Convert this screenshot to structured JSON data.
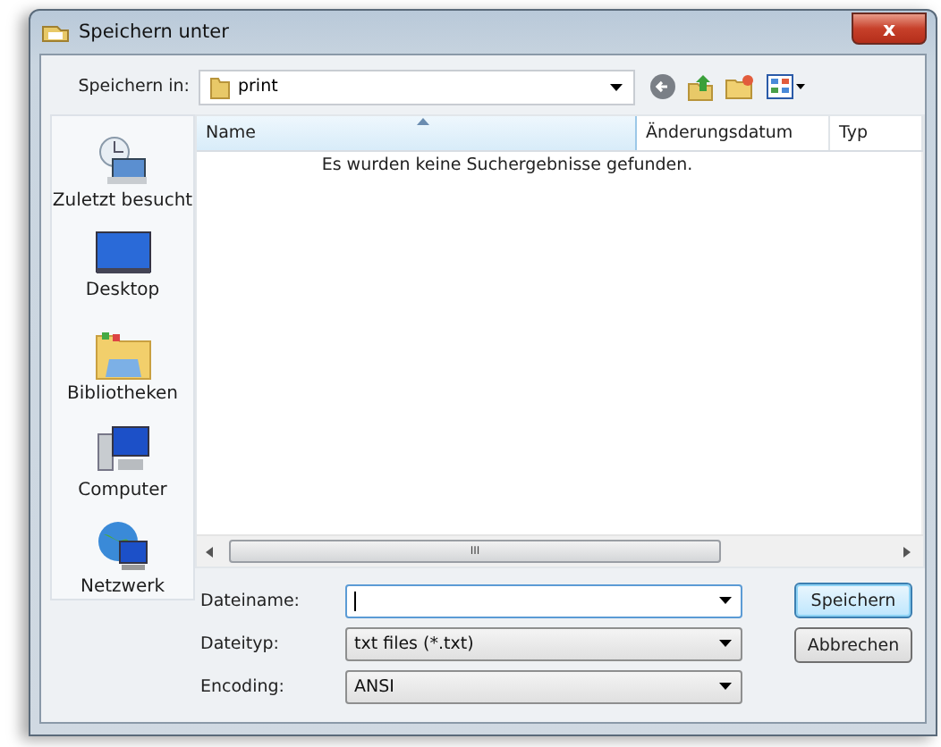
{
  "window": {
    "title": "Speichern unter",
    "close": "x"
  },
  "location": {
    "label": "Speichern in:",
    "value": "print"
  },
  "places": [
    {
      "label": "Zuletzt besucht",
      "kind": "recent"
    },
    {
      "label": "Desktop",
      "kind": "desktop"
    },
    {
      "label": "Bibliotheken",
      "kind": "libraries"
    },
    {
      "label": "Computer",
      "kind": "computer"
    },
    {
      "label": "Netzwerk",
      "kind": "network"
    }
  ],
  "table": {
    "columns": [
      {
        "label": "Name",
        "sorted": true
      },
      {
        "label": "Änderungsdatum",
        "sorted": false
      },
      {
        "label": "Typ",
        "sorted": false
      }
    ],
    "empty_message": "Es wurden keine Suchergebnisse gefunden."
  },
  "scrollbar": {
    "grip": "III"
  },
  "fields": [
    {
      "label": "Dateiname:",
      "focused": true
    },
    {
      "label": "Dateityp:",
      "value": "txt files (*.txt)",
      "focused": false
    },
    {
      "label": "Encoding:",
      "value": "ANSI",
      "focused": false
    }
  ],
  "buttons": [
    {
      "label": "Speichern",
      "default": true
    },
    {
      "label": "Abbrechen",
      "default": false
    }
  ]
}
